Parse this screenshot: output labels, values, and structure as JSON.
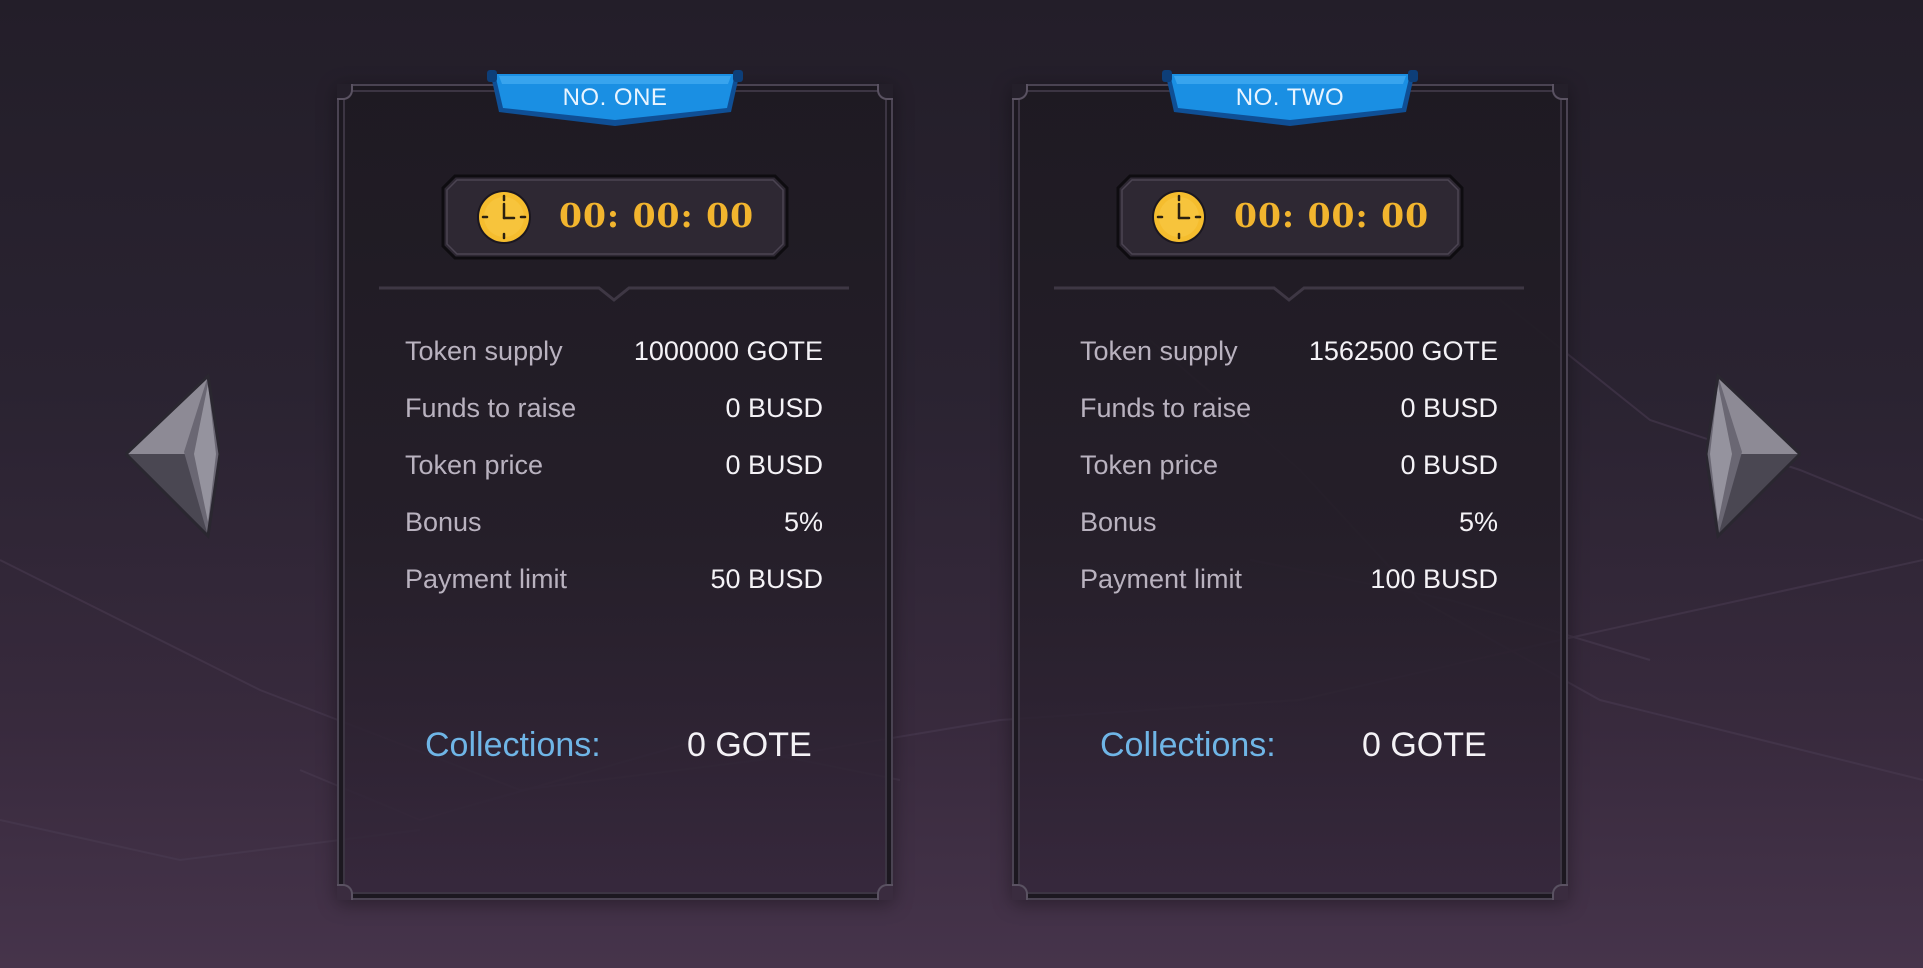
{
  "cards": [
    {
      "banner": "NO. ONE",
      "timer": "00: 00: 00",
      "stats": [
        {
          "label": "Token supply",
          "value": "1000000 GOTE"
        },
        {
          "label": "Funds to raise",
          "value": "0 BUSD"
        },
        {
          "label": "Token price",
          "value": "0 BUSD"
        },
        {
          "label": "Bonus",
          "value": "5%"
        },
        {
          "label": "Payment limit",
          "value": "50 BUSD"
        }
      ],
      "collections_label": "Collections:",
      "collections_value": "0 GOTE"
    },
    {
      "banner": "NO. TWO",
      "timer": "00: 00: 00",
      "stats": [
        {
          "label": "Token supply",
          "value": "1562500 GOTE"
        },
        {
          "label": "Funds to raise",
          "value": "0 BUSD"
        },
        {
          "label": "Token price",
          "value": "0 BUSD"
        },
        {
          "label": "Bonus",
          "value": "5%"
        },
        {
          "label": "Payment limit",
          "value": "100 BUSD"
        }
      ],
      "collections_label": "Collections:",
      "collections_value": "0 GOTE"
    }
  ],
  "icons": {
    "timer": "clock-icon",
    "prev": "arrow-left-icon",
    "next": "arrow-right-icon"
  },
  "colors": {
    "banner_blue": "#1a8fe3",
    "timer_gold": "#f2b52e",
    "collections_blue": "#6fb5e6"
  }
}
